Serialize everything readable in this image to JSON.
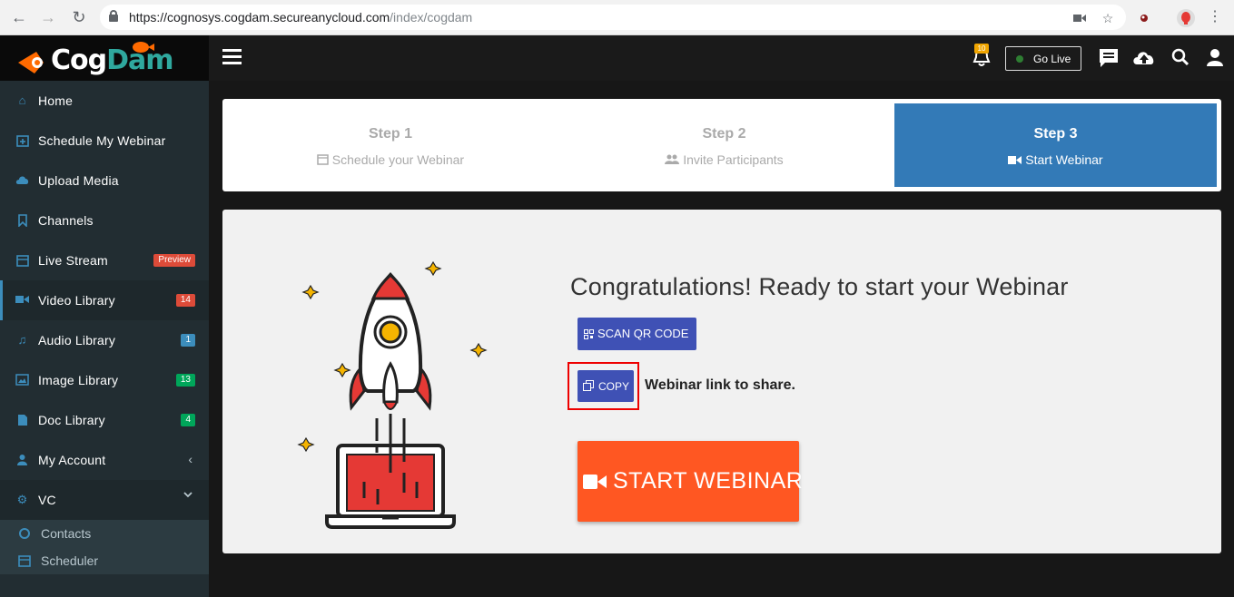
{
  "browser": {
    "url_host": "https://cognosys.cogdam.secureanycloud.com",
    "url_path": "/index/cogdam"
  },
  "app": {
    "logo_text_1": "Cog",
    "logo_text_2": "Dam"
  },
  "topbar": {
    "notification_count": "10",
    "go_live_label": "Go Live"
  },
  "sidebar": {
    "items": [
      {
        "label": "Home",
        "icon": "home-icon"
      },
      {
        "label": "Schedule My Webinar",
        "icon": "calendar-plus-icon"
      },
      {
        "label": "Upload Media",
        "icon": "cloud-upload-icon"
      },
      {
        "label": "Channels",
        "icon": "bookmark-icon"
      },
      {
        "label": "Live Stream",
        "icon": "calendar-icon",
        "badge": "Preview",
        "badge_color": "#dd4b39"
      },
      {
        "label": "Video Library",
        "icon": "video-camera-icon",
        "badge": "14",
        "badge_color": "#dd4b39"
      },
      {
        "label": "Audio Library",
        "icon": "music-icon",
        "badge": "1",
        "badge_color": "#3c8dbc"
      },
      {
        "label": "Image Library",
        "icon": "image-icon",
        "badge": "13",
        "badge_color": "#00a65a"
      },
      {
        "label": "Doc Library",
        "icon": "document-icon",
        "badge": "4",
        "badge_color": "#00a65a"
      },
      {
        "label": "My Account",
        "icon": "user-icon"
      },
      {
        "label": "VC",
        "icon": "cogs-icon"
      }
    ],
    "sub_items": [
      {
        "label": "Contacts",
        "icon": "circle-icon"
      },
      {
        "label": "Scheduler",
        "icon": "calendar-icon"
      }
    ]
  },
  "steps": [
    {
      "title": "Step 1",
      "subtitle": "Schedule your Webinar"
    },
    {
      "title": "Step 2",
      "subtitle": "Invite Participants"
    },
    {
      "title": "Step 3",
      "subtitle": "Start Webinar"
    }
  ],
  "main": {
    "heading": "Congratulations! Ready to start your Webinar",
    "scan_qr_label": "SCAN QR CODE",
    "copy_label": "COPY",
    "share_text": "Webinar link to share.",
    "start_label": "START WEBINAR"
  },
  "colors": {
    "accent": "#3c8dbc",
    "primary_button": "#3f51b5",
    "start_button": "#ff5722",
    "highlight": "#ee0000"
  }
}
